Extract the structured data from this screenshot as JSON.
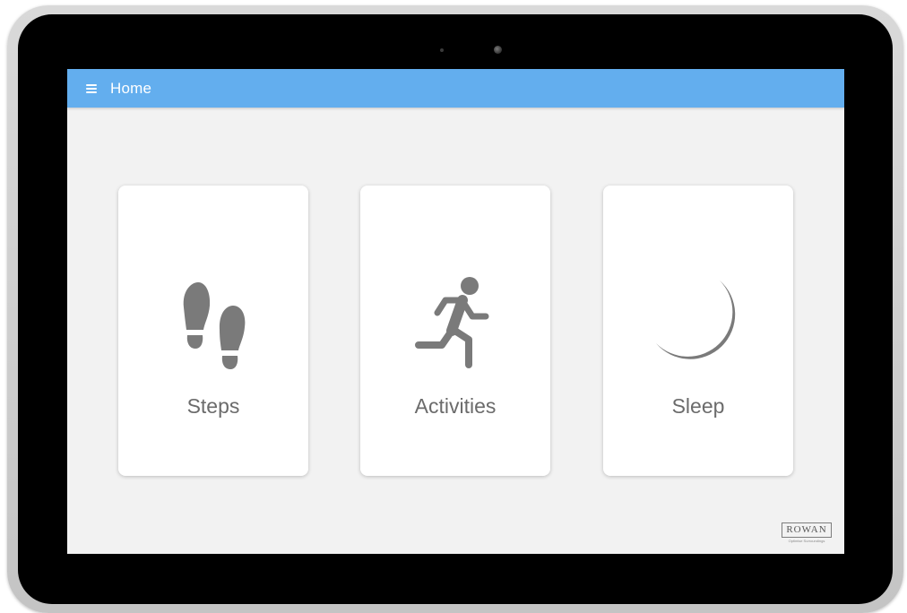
{
  "app_bar": {
    "title": "Home",
    "menu_icon": "hamburger-menu-icon",
    "color": "#63aeee"
  },
  "cards": [
    {
      "label": "Steps",
      "icon": "footprints-icon"
    },
    {
      "label": "Activities",
      "icon": "running-person-icon"
    },
    {
      "label": "Sleep",
      "icon": "crescent-moon-icon"
    }
  ],
  "brand": {
    "name": "ROWAN",
    "tagline": "Optimise Surroundings"
  },
  "colors": {
    "icon": "#7a7a7a",
    "label": "#6b6b6b",
    "screen_background": "#f2f2f2",
    "card_background": "#ffffff"
  }
}
